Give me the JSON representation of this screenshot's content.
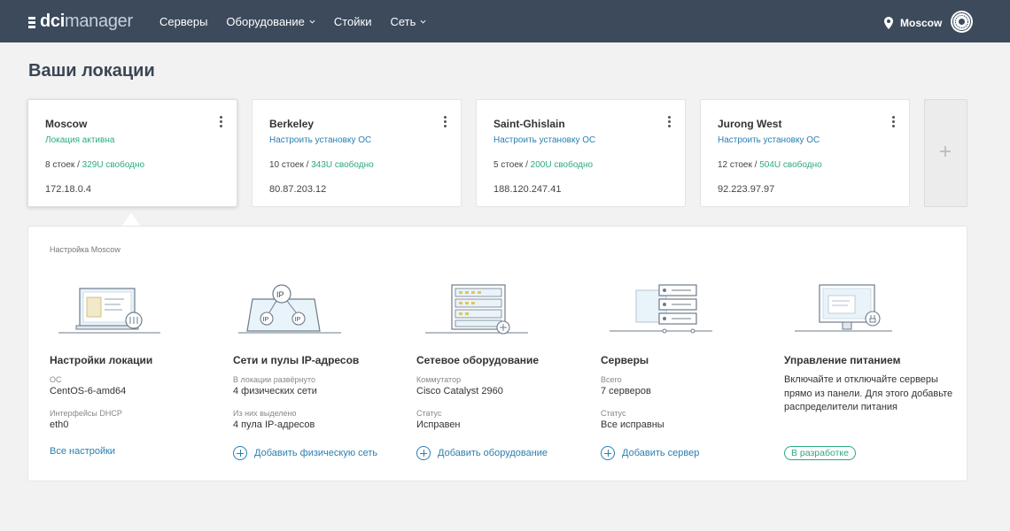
{
  "header": {
    "logo_prefix": "dci",
    "logo_suffix": "manager",
    "nav": [
      {
        "label": "Серверы",
        "dropdown": false
      },
      {
        "label": "Оборудование",
        "dropdown": true
      },
      {
        "label": "Стойки",
        "dropdown": false
      },
      {
        "label": "Сеть",
        "dropdown": true
      }
    ],
    "current_location": "Moscow",
    "colors": {
      "bg": "#3c4a5c"
    }
  },
  "page_title": "Ваши локации",
  "locations": [
    {
      "name": "Moscow",
      "status": "Локация активна",
      "status_color": "green",
      "racks": "8 стоек",
      "free": "329U свободно",
      "ip": "172.18.0.4",
      "active": true
    },
    {
      "name": "Berkeley",
      "status": "Настроить установку ОС",
      "status_color": "blue",
      "racks": "10 стоек",
      "free": "343U свободно",
      "ip": "80.87.203.12",
      "active": false
    },
    {
      "name": "Saint-Ghislain",
      "status": "Настроить установку ОС",
      "status_color": "blue",
      "racks": "5 стоек",
      "free": "200U свободно",
      "ip": "188.120.247.41",
      "active": false
    },
    {
      "name": "Jurong West",
      "status": "Настроить установку ОС",
      "status_color": "blue",
      "racks": "12 стоек",
      "free": "504U свободно",
      "ip": "92.223.97.97",
      "active": false
    }
  ],
  "add_location_glyph": "+",
  "panel": {
    "title": "Настройка Moscow",
    "columns": [
      {
        "title": "Настройки локации",
        "fields": [
          {
            "label": "ОС",
            "value": "CentOS-6-amd64"
          },
          {
            "label": "Интерфейсы DHCP",
            "value": "eth0"
          }
        ],
        "link": "Все настройки"
      },
      {
        "title": "Сети и пулы IP-адресов",
        "fields": [
          {
            "label": "В локации развёрнуто",
            "value": "4 физических сети"
          },
          {
            "label": "Из них выделено",
            "value": "4 пула IP-адресов"
          }
        ],
        "link": "Добавить физическую сеть"
      },
      {
        "title": "Сетевое оборудование",
        "fields": [
          {
            "label": "Коммутатор",
            "value": "Cisco Catalyst 2960"
          },
          {
            "label": "Статус",
            "value": "Исправен"
          }
        ],
        "link": "Добавить оборудование"
      },
      {
        "title": "Серверы",
        "fields": [
          {
            "label": "Всего",
            "value": "7 серверов"
          },
          {
            "label": "Статус",
            "value": "Все исправны"
          }
        ],
        "link": "Добавить сервер"
      },
      {
        "title": "Управление питанием",
        "description": "Включайте и отключайте серверы прямо из панели. Для этого добавьте распределители питания",
        "badge": "В разработке"
      }
    ]
  }
}
